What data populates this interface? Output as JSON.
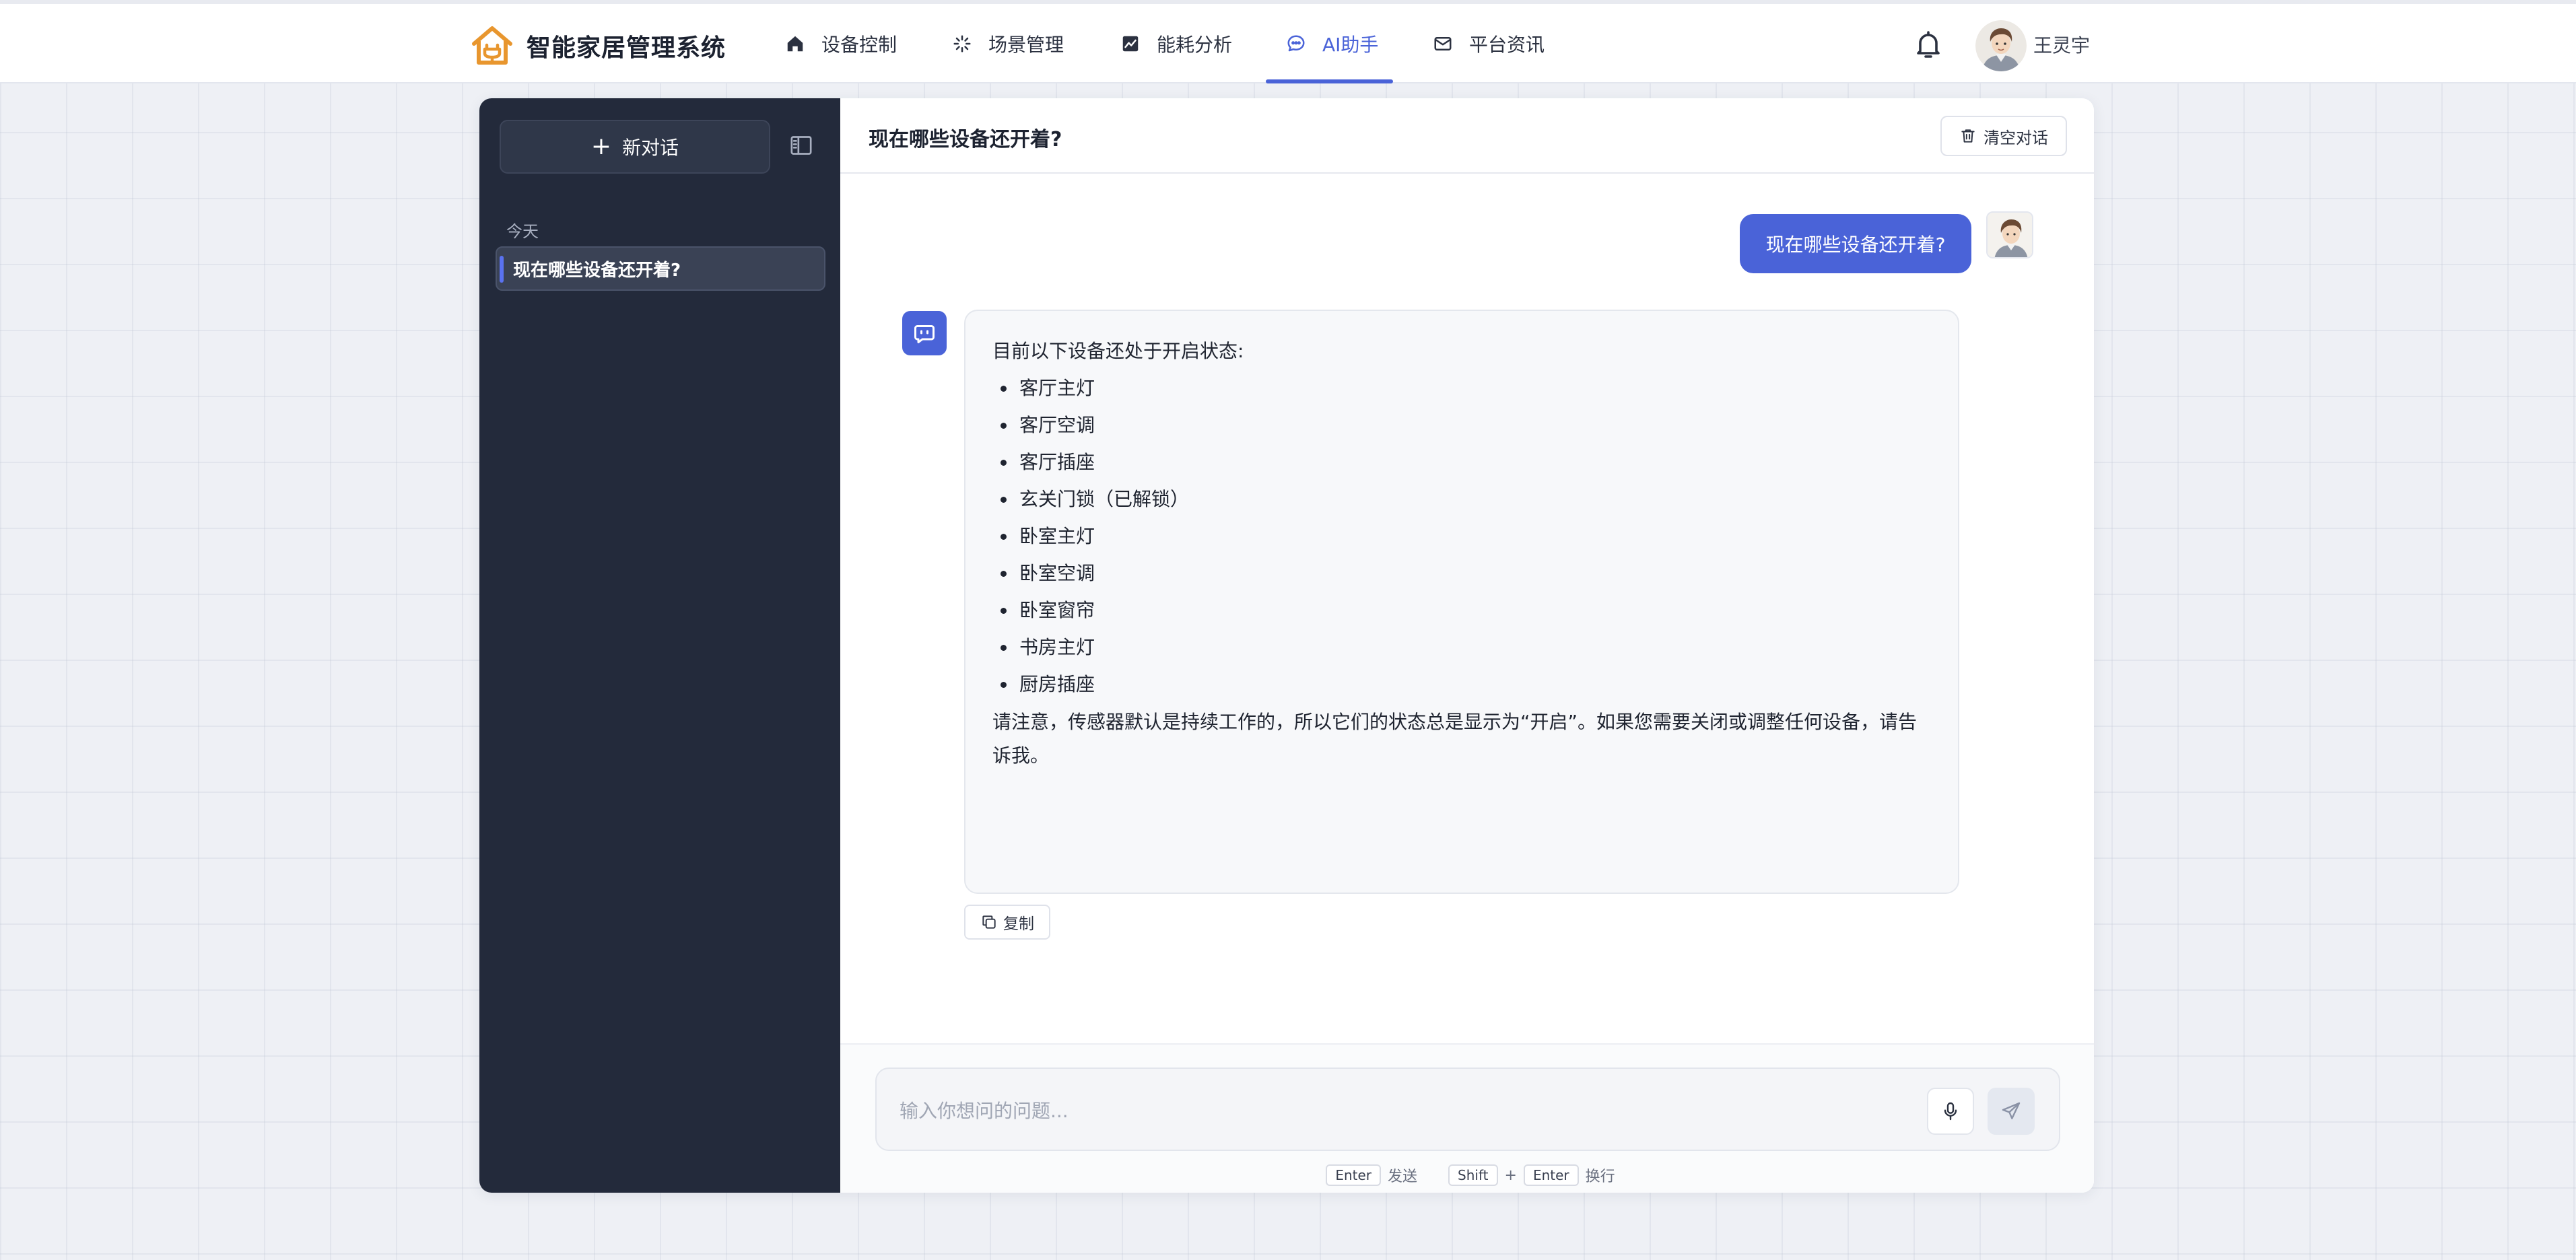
{
  "brand": {
    "title": "智能家居管理系统",
    "logo_icon": "house-plug-icon",
    "accent": "#e8962e"
  },
  "nav": {
    "items": [
      {
        "label": "设备控制",
        "icon": "home-icon"
      },
      {
        "label": "场景管理",
        "icon": "sparkle-icon"
      },
      {
        "label": "能耗分析",
        "icon": "chart-icon"
      },
      {
        "label": "AI助手",
        "icon": "chat-bubble-icon",
        "active": true
      },
      {
        "label": "平台资讯",
        "icon": "mail-icon"
      }
    ]
  },
  "user": {
    "name": "王灵宇",
    "avatar_icon": "user-avatar"
  },
  "sidebar": {
    "new_chat_label": "新对话",
    "section_today": "今天",
    "conversations": [
      {
        "title": "现在哪些设备还开着?",
        "active": true
      }
    ]
  },
  "chat": {
    "title": "现在哪些设备还开着?",
    "clear_label": "清空对话",
    "user_message": "现在哪些设备还开着?",
    "bot_message": {
      "intro": "目前以下设备还处于开启状态:",
      "devices": [
        "客厅主灯",
        "客厅空调",
        "客厅插座",
        "玄关门锁（已解锁）",
        "卧室主灯",
        "卧室空调",
        "卧室窗帘",
        "书房主灯",
        "厨房插座"
      ],
      "note": "请注意，传感器默认是持续工作的，所以它们的状态总是显示为“开启”。如果您需要关闭或调整任何设备，请告诉我。"
    },
    "copy_label": "复制"
  },
  "input": {
    "placeholder": "输入你想问的问题...",
    "hint_enter_key": "Enter",
    "hint_enter_action": "发送",
    "hint_shift_key": "Shift",
    "hint_plus": "+",
    "hint_shift_enter_key": "Enter",
    "hint_shift_action": "换行"
  },
  "colors": {
    "primary": "#4a63d8",
    "sidebar_bg": "#232a3b"
  }
}
